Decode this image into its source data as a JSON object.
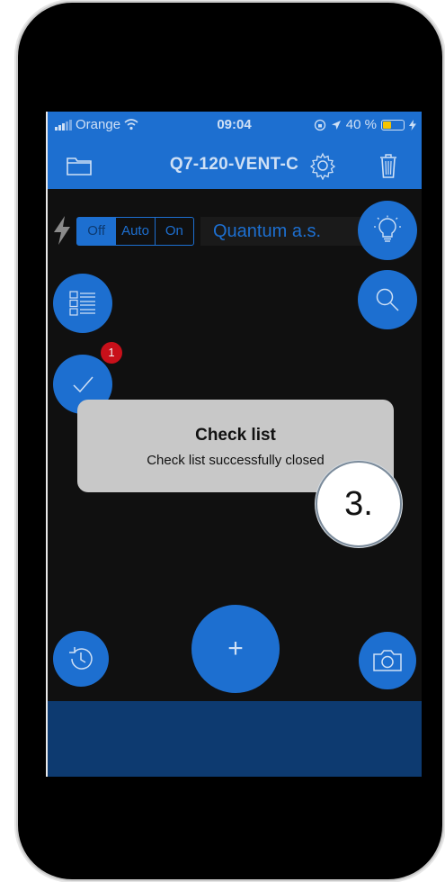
{
  "status_bar": {
    "carrier": "Orange",
    "time": "09:04",
    "battery_text": "40 %",
    "battery_level": 0.4
  },
  "header": {
    "title": "Q7-120-VENT-C",
    "icons": [
      "folder-icon",
      "gear-icon",
      "trash-icon"
    ]
  },
  "controls": {
    "mode_options": [
      "Off",
      "Auto",
      "On"
    ],
    "selected_mode": "Off",
    "company": "Quantum a.s."
  },
  "checklist": {
    "badge_count": "1"
  },
  "toast": {
    "title": "Check list",
    "message": "Check list successfully closed"
  },
  "fab": {
    "add_label": "+"
  },
  "callout": {
    "label": "3."
  },
  "colors": {
    "accent": "#1d6fd0",
    "panel": "#0d3a70",
    "badge": "#c8101a",
    "toast": "#c8c8c8",
    "battery": "#f5c400"
  }
}
